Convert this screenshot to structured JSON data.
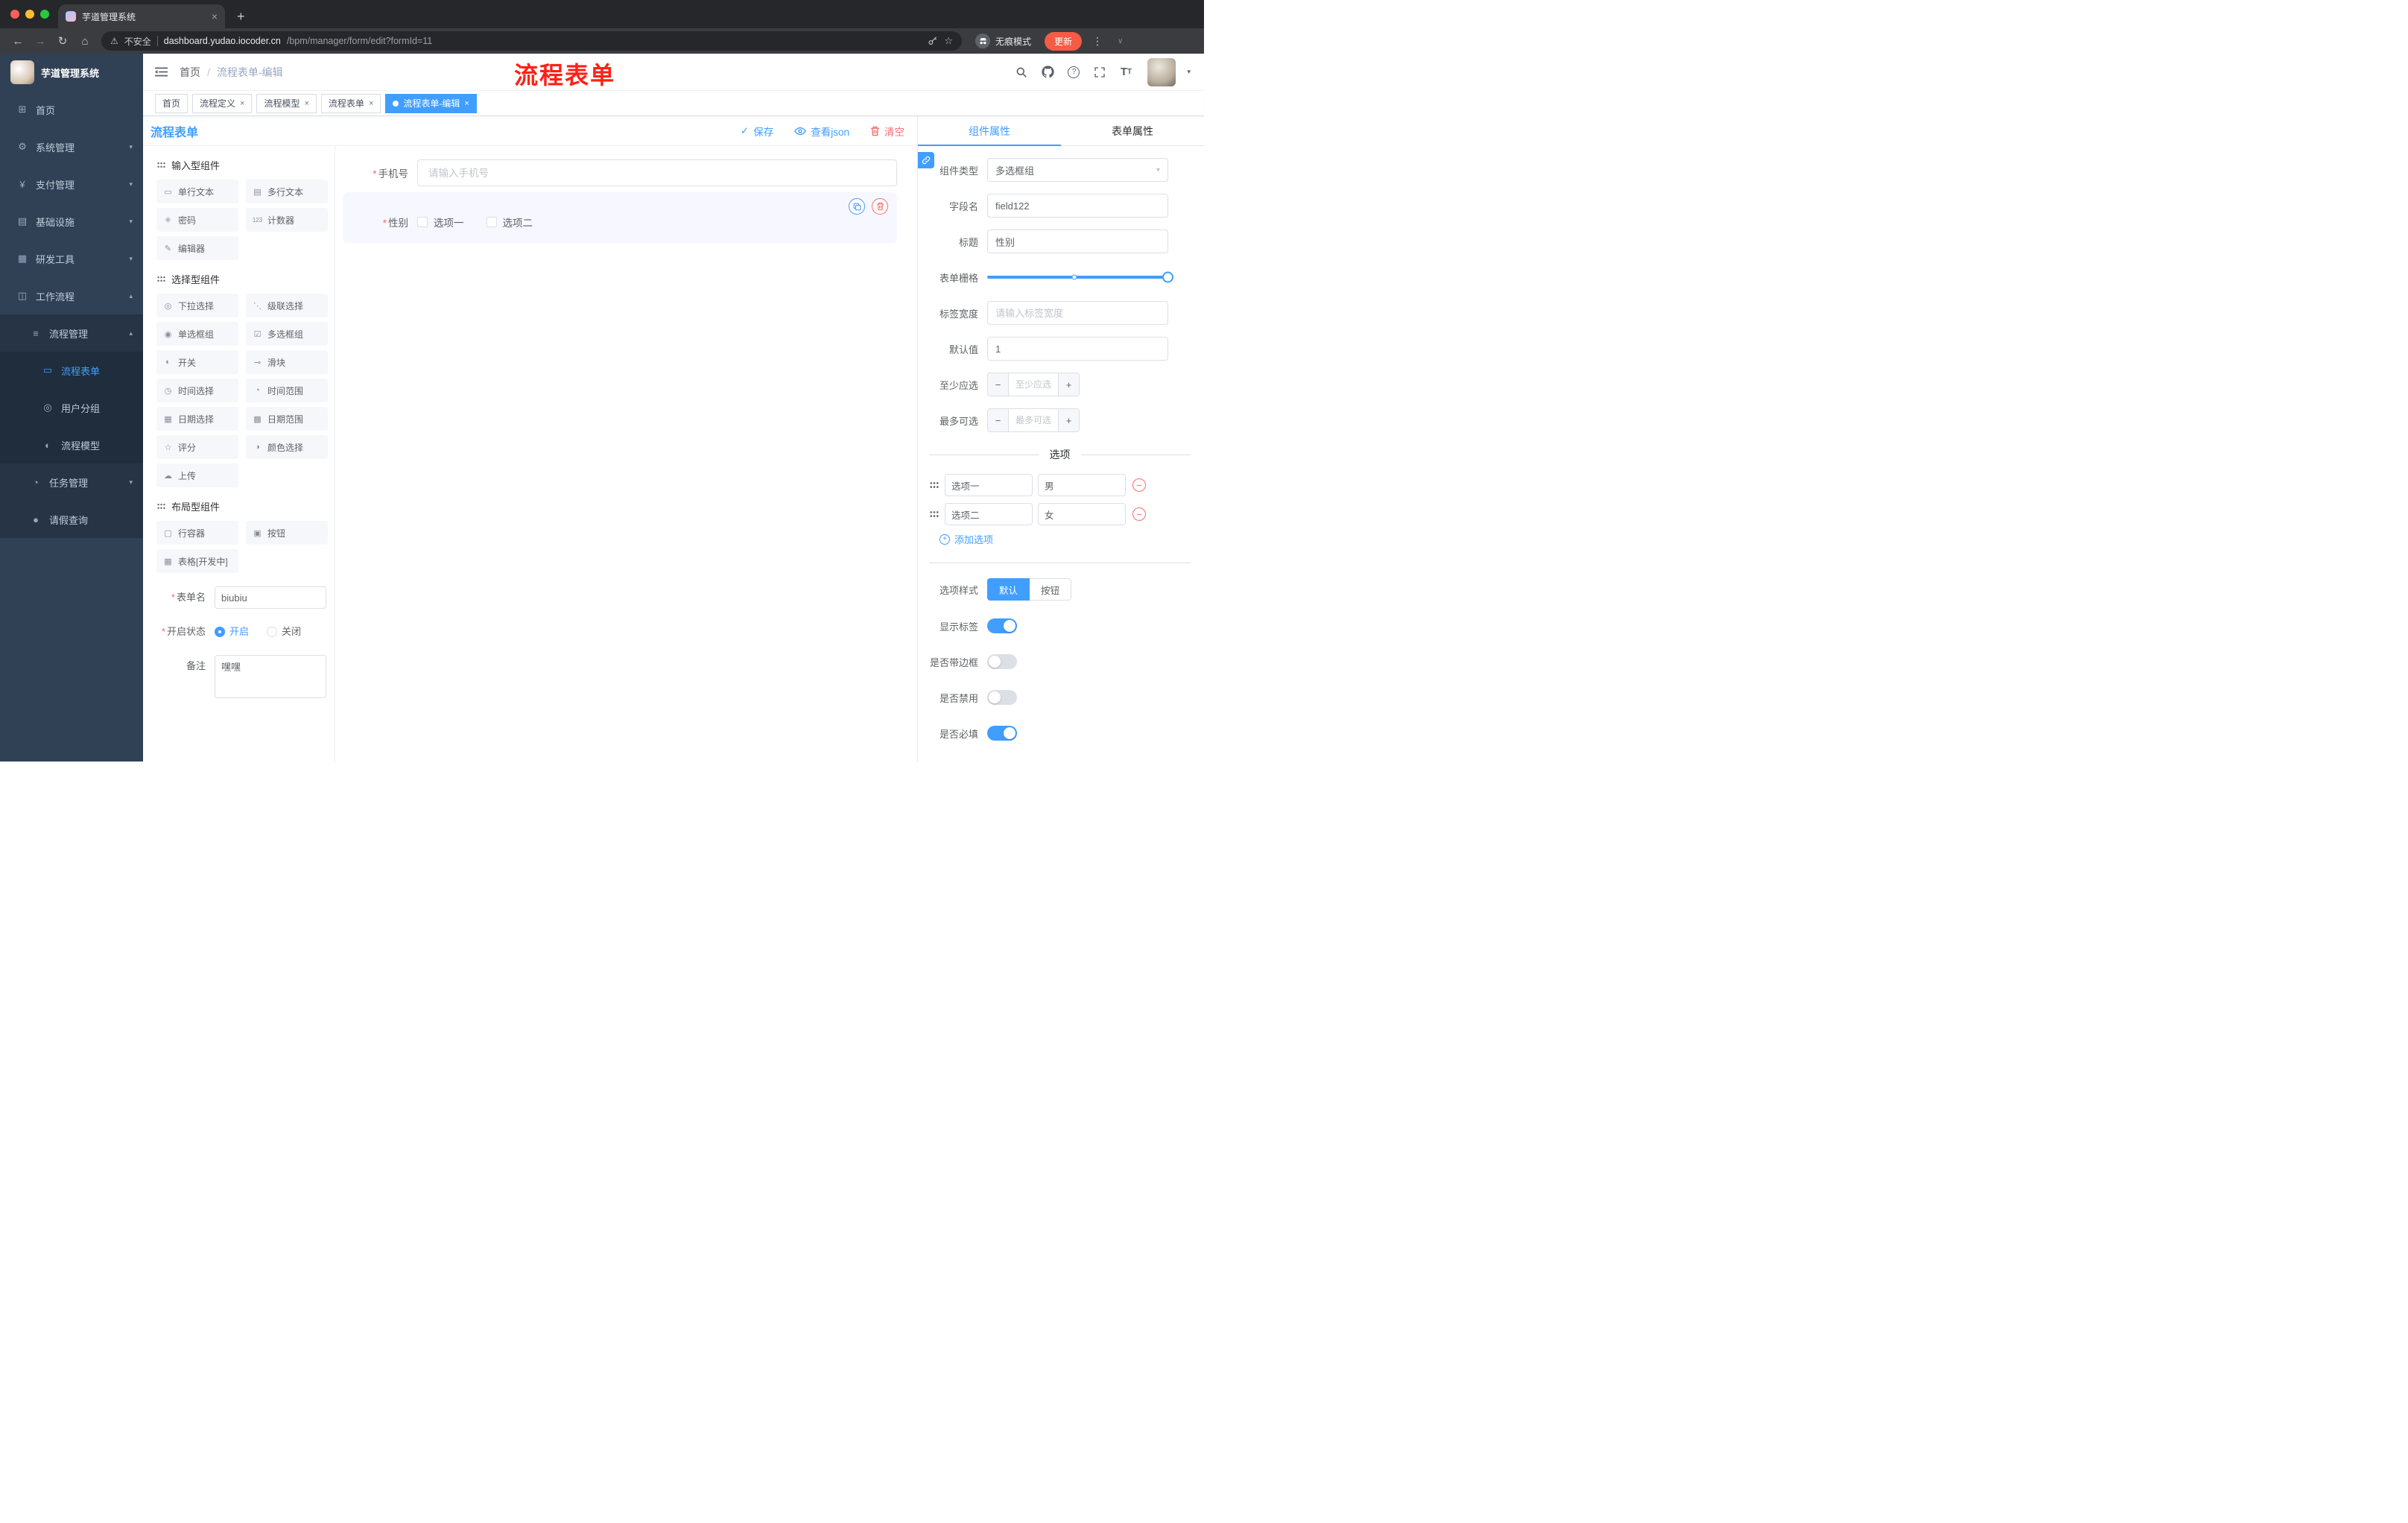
{
  "colors": {
    "primary": "#409EFF",
    "danger": "#F56C6C",
    "sidebar_bg": "#304156"
  },
  "icons": {
    "close": "×",
    "plus": "+",
    "minus": "−",
    "dots": "⋮",
    "back": "←",
    "forward": "→",
    "reload": "↻",
    "home": "⌂",
    "star": "☆",
    "warning": "⚠",
    "caret_down": "▾",
    "check": "✓",
    "chevron_down": "∨",
    "question": "?",
    "font_size": "T",
    "new_tab": "+"
  },
  "browser": {
    "tab_title": "芋道管理系统",
    "security_label": "不安全",
    "url_host": "dashboard.yudao.iocoder.cn",
    "url_path": "/bpm/manager/form/edit?formId=11",
    "incognito_label": "无痕模式",
    "update_label": "更新"
  },
  "annotation": {
    "text": "流程表单"
  },
  "sidebar": {
    "brand": "芋道管理系统",
    "menu": [
      {
        "glyph": "⊞",
        "label": "首页",
        "arrow": ""
      },
      {
        "glyph": "⚙",
        "label": "系统管理",
        "arrow": "▾"
      },
      {
        "glyph": "¥",
        "label": "支付管理",
        "arrow": "▾"
      },
      {
        "glyph": "▤",
        "label": "基础设施",
        "arrow": "▾"
      },
      {
        "glyph": "▦",
        "label": "研发工具",
        "arrow": "▾"
      },
      {
        "glyph": "◫",
        "label": "工作流程",
        "arrow": "▴"
      },
      {
        "glyph": "≡",
        "label": "流程管理",
        "arrow": "▴"
      },
      {
        "glyph": "▭",
        "label": "流程表单",
        "arrow": ""
      },
      {
        "glyph": "◎",
        "label": "用户分组",
        "arrow": ""
      },
      {
        "glyph": "◐",
        "label": "流程模型",
        "arrow": ""
      },
      {
        "glyph": "◔",
        "label": "任务管理",
        "arrow": "▾"
      },
      {
        "glyph": "●",
        "label": "请假查询",
        "arrow": ""
      }
    ]
  },
  "header": {
    "breadcrumb_home": "首页",
    "breadcrumb_separator": "/",
    "breadcrumb_current": "流程表单-编辑"
  },
  "tags": [
    {
      "label": "首页"
    },
    {
      "label": "流程定义"
    },
    {
      "label": "流程模型"
    },
    {
      "label": "流程表单"
    },
    {
      "label": "流程表单-编辑"
    }
  ],
  "designer": {
    "title": "流程表单",
    "save": "保存",
    "view_json": "查看json",
    "clear": "清空"
  },
  "palette": {
    "sections": [
      {
        "title": "输入型组件",
        "items": [
          {
            "glyph": "▭",
            "label": "单行文本"
          },
          {
            "glyph": "▤",
            "label": "多行文本"
          },
          {
            "glyph": "✳",
            "label": "密码"
          },
          {
            "glyph": "123",
            "label": "计数器"
          },
          {
            "glyph": "✎",
            "label": "编辑器"
          }
        ]
      },
      {
        "title": "选择型组件",
        "items": [
          {
            "glyph": "◎",
            "label": "下拉选择"
          },
          {
            "glyph": "⋱",
            "label": "级联选择"
          },
          {
            "glyph": "◉",
            "label": "单选框组"
          },
          {
            "glyph": "☑",
            "label": "多选框组"
          },
          {
            "glyph": "◐",
            "label": "开关"
          },
          {
            "glyph": "⊸",
            "label": "滑块"
          },
          {
            "glyph": "◷",
            "label": "时间选择"
          },
          {
            "glyph": "◔",
            "label": "时间范围"
          },
          {
            "glyph": "▦",
            "label": "日期选择"
          },
          {
            "glyph": "▩",
            "label": "日期范围"
          },
          {
            "glyph": "☆",
            "label": "评分"
          },
          {
            "glyph": "◑",
            "label": "颜色选择"
          },
          {
            "glyph": "☁",
            "label": "上传"
          }
        ]
      },
      {
        "title": "布局型组件",
        "items": [
          {
            "glyph": "▢",
            "label": "行容器"
          },
          {
            "glyph": "▣",
            "label": "按钮"
          },
          {
            "glyph": "▦",
            "label": "表格[开发中]"
          }
        ]
      }
    ]
  },
  "meta": {
    "form_name_label": "表单名",
    "form_name_value": "biubiu",
    "status_label": "开启状态",
    "status_on": "开启",
    "status_off": "关闭",
    "remark_label": "备注",
    "remark_value": "嘿嘿"
  },
  "canvas": {
    "phone": {
      "label": "手机号",
      "placeholder": "请输入手机号"
    },
    "gender": {
      "label": "性别",
      "option1": "选项一",
      "option2": "选项二"
    }
  },
  "props": {
    "tab_component": "组件属性",
    "tab_form": "表单属性",
    "rows": {
      "type_label": "组件类型",
      "type_value": "多选框组",
      "field_label": "字段名",
      "field_value": "field122",
      "title_label": "标题",
      "title_value": "性别",
      "grid_label": "表单栅格",
      "labelwidth_label": "标签宽度",
      "labelwidth_placeholder": "请输入标签宽度",
      "default_label": "默认值",
      "default_value": "1",
      "min_label": "至少应选",
      "min_placeholder": "至少应选",
      "max_label": "最多可选",
      "max_placeholder": "最多可选"
    },
    "options_title": "选项",
    "options": [
      {
        "label": "选项一",
        "value": "男"
      },
      {
        "label": "选项二",
        "value": "女"
      }
    ],
    "add_option": "添加选项",
    "style_label": "选项样式",
    "style_default": "默认",
    "style_button": "按钮",
    "switch_show_label": "显示标签",
    "switch_border": "是否带边框",
    "switch_disabled": "是否禁用",
    "switch_required": "是否必填"
  }
}
